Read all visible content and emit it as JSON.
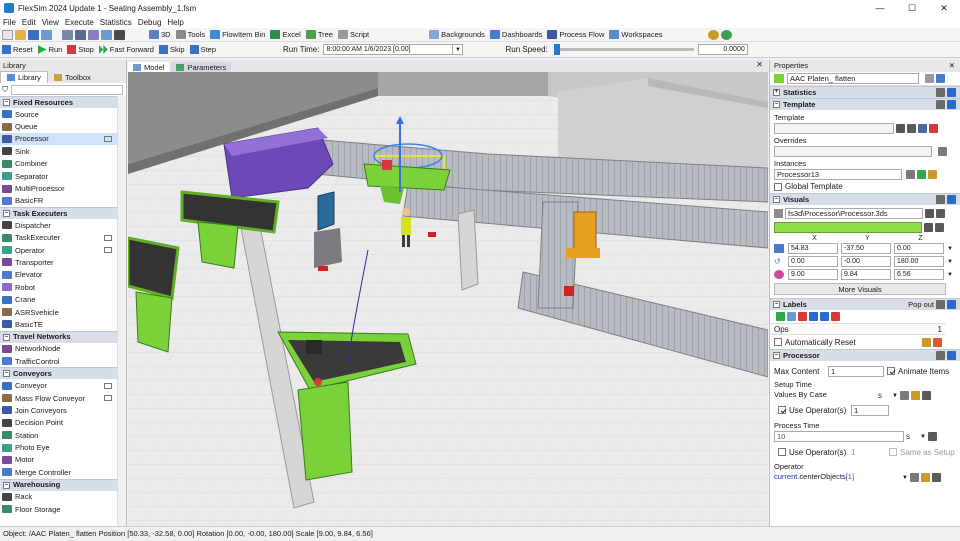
{
  "window": {
    "title": "FlexSim 2024 Update 1 - Seating Assembly_1.fsm",
    "controls": [
      "—",
      "☐",
      "✕"
    ]
  },
  "menu": [
    "File",
    "Edit",
    "View",
    "Execute",
    "Statistics",
    "Debug",
    "Help"
  ],
  "toolbar": {
    "buttons": [
      "3D",
      "Tools",
      "FlowItem Bin",
      "Excel",
      "Tree",
      "Script",
      "Backgrounds",
      "Dashboards",
      "Process Flow",
      "Workspaces"
    ]
  },
  "runbar": {
    "reset": "Reset",
    "run": "Run",
    "stop": "Stop",
    "fast_forward": "Fast Forward",
    "skip": "Skip",
    "step": "Step",
    "run_time_label": "Run Time:",
    "run_time_value": "8:00:00 AM  1/6/2023  [0.00]",
    "run_speed_label": "Run Speed:",
    "run_speed_value": "0.0000",
    "run_speed_fraction": 0.0
  },
  "library": {
    "header": "Library",
    "tabs": [
      "Library",
      "Toolbox"
    ],
    "categories": [
      {
        "name": "Fixed Resources",
        "items": [
          "Source",
          "Queue",
          "Processor",
          "Sink",
          "Combiner",
          "Separator",
          "MultiProcessor",
          "BasicFR"
        ]
      },
      {
        "name": "Task Executers",
        "items": [
          "Dispatcher",
          "TaskExecuter",
          "Operator",
          "Transporter",
          "Elevator",
          "Robot",
          "Crane",
          "ASRSvehicle",
          "BasicTE"
        ]
      },
      {
        "name": "Travel Networks",
        "items": [
          "NetworkNode",
          "TrafficControl"
        ]
      },
      {
        "name": "Conveyors",
        "items": [
          "Conveyor",
          "Mass Flow Conveyor",
          "Join Conveyors",
          "Decision Point",
          "Station",
          "Photo Eye",
          "Motor",
          "Merge Controller"
        ]
      },
      {
        "name": "Warehousing",
        "items": [
          "Rack",
          "Floor Storage"
        ]
      }
    ],
    "selected": "Processor"
  },
  "model_tabs": {
    "tabs": [
      "Model",
      "Parameters"
    ],
    "close": "✕"
  },
  "properties": {
    "header": "Properties",
    "object_name": "AAC Platen_ flatten",
    "statistics": "Statistics",
    "template_section": "Template",
    "template_label": "Template",
    "overrides_label": "Overrides",
    "instances_label": "Instances",
    "instances_value": "Processor13",
    "global_template": "Global Template",
    "visuals_section": "Visuals",
    "shape_file": "fs3d\\Processor\\Processor.3ds",
    "color": "#8fe04a",
    "axis": [
      "X",
      "Y",
      "Z"
    ],
    "position": [
      "54.83",
      "-37.50",
      "0.00"
    ],
    "rotation": [
      "0.00",
      "-0.00",
      "180.00"
    ],
    "scale": [
      "9.00",
      "9.84",
      "6.56"
    ],
    "more_visuals": "More Visuals",
    "labels_section": "Labels",
    "pop_out": "Pop out",
    "label_name": "Ops",
    "label_value": "1",
    "auto_reset": "Automatically Reset",
    "processor_section": "Processor",
    "max_content_label": "Max Content",
    "max_content": "1",
    "animate_items": "Animate Items",
    "setup_time_label": "Setup Time",
    "setup_time_value": "Values By Case",
    "unit_s": "s",
    "use_operators": "Use Operator(s)",
    "setup_ops": "1",
    "process_time_label": "Process Time",
    "process_time": "10",
    "process_ops": "1",
    "same_as_setup": "Same as Setup",
    "operator_label": "Operator",
    "operator_prefix": "current",
    "operator_member": ".centerObjects",
    "operator_index": "[1]"
  },
  "status": "Object: /AAC Platen_ flatten  Position [50.33, -32.58, 0.00]  Rotation [0.00, -0.00, 180.00]  Scale [9.00, 9.84, 6.56]"
}
